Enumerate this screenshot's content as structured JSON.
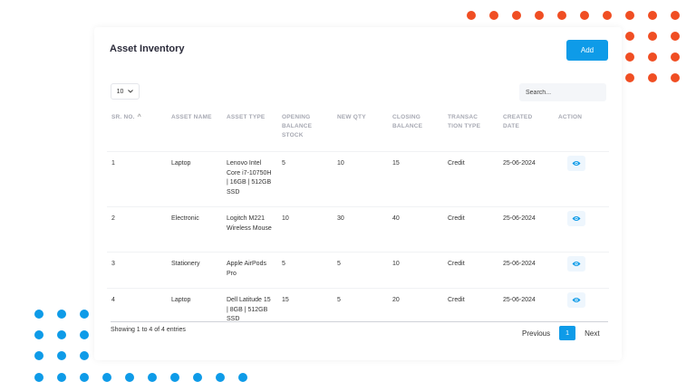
{
  "title": "Asset Inventory",
  "add_label": "Add",
  "page_size": "10",
  "search_placeholder": "Search...",
  "columns": {
    "sr_no": "SR. NO.",
    "asset_name": "ASSET NAME",
    "asset_type": "ASSET TYPE",
    "opening": "OPENING BALANCE STOCK",
    "new_qty": "NEW QTY",
    "closing": "CLOSING BALANCE",
    "transaction": "TRANSAC TION TYPE",
    "created": "CREATED DATE",
    "action": "ACTION"
  },
  "rows": [
    {
      "sr": "1",
      "name": "Laptop",
      "type": "Lenovo Intel Core i7-10750H | 16GB | 512GB SSD",
      "opening": "5",
      "new_qty": "10",
      "closing": "15",
      "transaction": "Credit",
      "date": "25-06-2024"
    },
    {
      "sr": "2",
      "name": "Electronic",
      "type": "Logitch M221 Wireless Mouse",
      "opening": "10",
      "new_qty": "30",
      "closing": "40",
      "transaction": "Credit",
      "date": "25-06-2024"
    },
    {
      "sr": "3",
      "name": "Stationery",
      "type": "Apple AirPods Pro",
      "opening": "5",
      "new_qty": "5",
      "closing": "10",
      "transaction": "Credit",
      "date": "25-06-2024"
    },
    {
      "sr": "4",
      "name": "Laptop",
      "type": "Dell Latitude 15 | 8GB | 512GB SSD",
      "opening": "15",
      "new_qty": "5",
      "closing": "20",
      "transaction": "Credit",
      "date": "25-06-2024"
    }
  ],
  "info": "Showing 1 to 4 of 4 entries",
  "pagination": {
    "previous": "Previous",
    "current": "1",
    "next": "Next"
  },
  "icons": {
    "sort": "sort-up-icon",
    "view": "eye-icon",
    "dropdown": "chevron-down-icon"
  },
  "colors": {
    "accent": "#0e9be8",
    "dots_orange": "#f04e23",
    "dots_blue": "#0e9be8"
  }
}
